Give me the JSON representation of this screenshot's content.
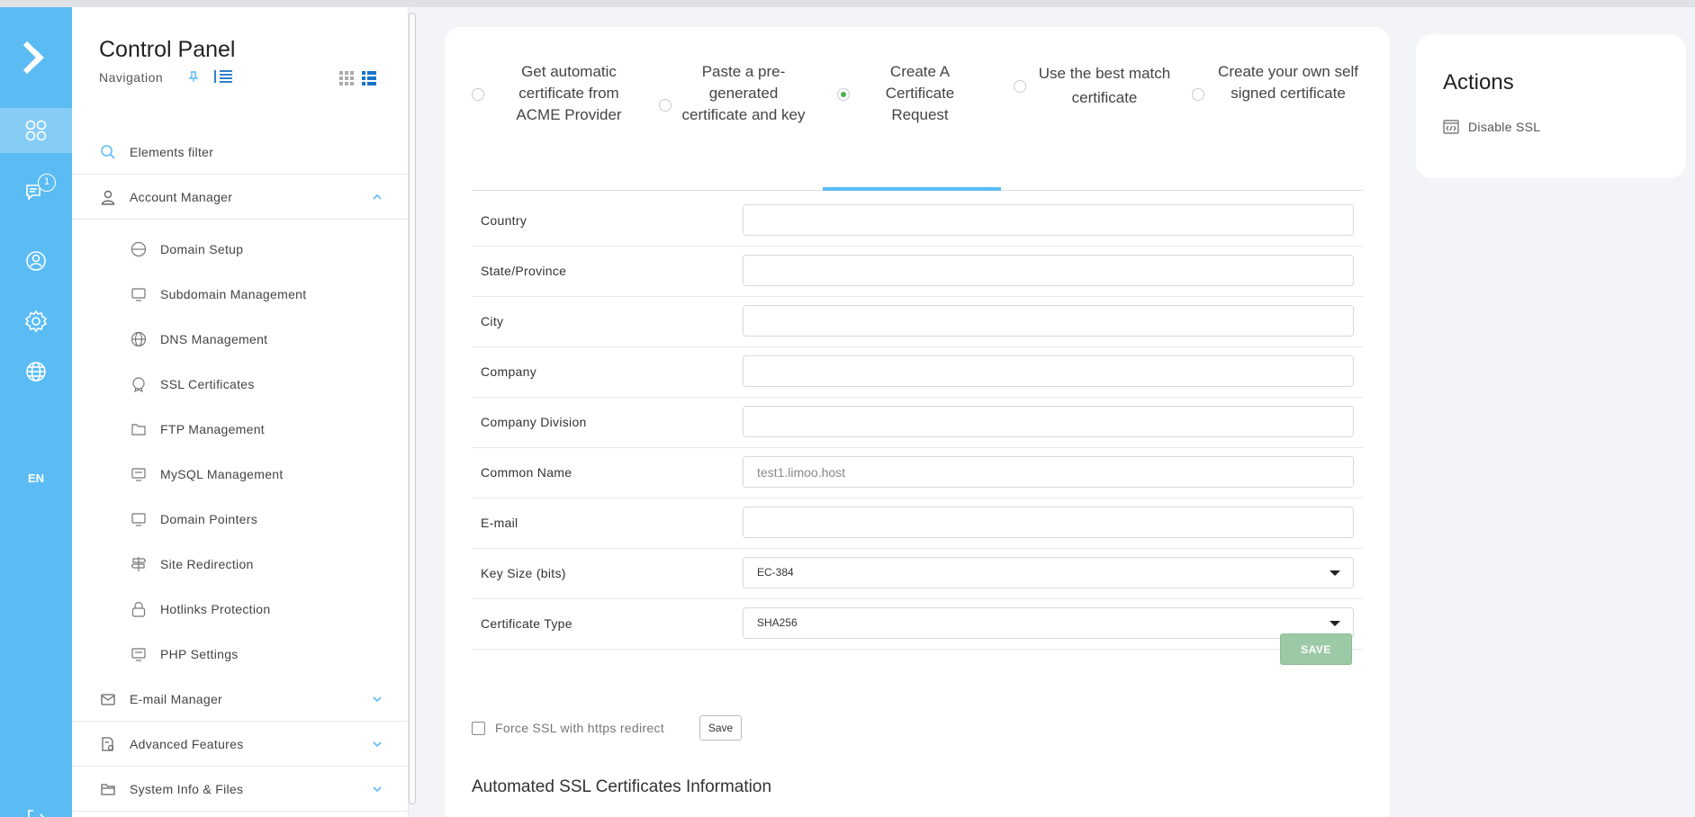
{
  "rail": {
    "badge_count": "1",
    "language": "EN",
    "icons": [
      "logo-icon",
      "dashboard-icon",
      "messages-icon",
      "user-icon",
      "settings-icon",
      "globe-icon",
      "logout-icon"
    ]
  },
  "sidebar": {
    "title": "Control Panel",
    "subtitle": "Navigation",
    "filter_label": "Elements filter",
    "account_manager": "Account Manager",
    "items": [
      {
        "label": "Domain Setup",
        "icon": "domain-setup-icon"
      },
      {
        "label": "Subdomain Management",
        "icon": "subdomain-icon"
      },
      {
        "label": "DNS Management",
        "icon": "dns-icon"
      },
      {
        "label": "SSL Certificates",
        "icon": "ssl-icon"
      },
      {
        "label": "FTP Management",
        "icon": "ftp-icon"
      },
      {
        "label": "MySQL Management",
        "icon": "mysql-icon"
      },
      {
        "label": "Domain Pointers",
        "icon": "domain-pointers-icon"
      },
      {
        "label": "Site Redirection",
        "icon": "site-redirection-icon"
      },
      {
        "label": "Hotlinks Protection",
        "icon": "lock-icon"
      },
      {
        "label": "PHP Settings",
        "icon": "php-icon"
      }
    ],
    "sections": [
      {
        "label": "E-mail Manager"
      },
      {
        "label": "Advanced Features"
      },
      {
        "label": "System Info & Files"
      }
    ]
  },
  "tabs": [
    {
      "label": "Get automatic certificate from ACME Provider",
      "selected": false
    },
    {
      "label": "Paste a pre-generated certificate and key",
      "selected": false
    },
    {
      "label": "Create A Certificate Request",
      "selected": true
    },
    {
      "label": "Use the best match certificate",
      "selected": false
    },
    {
      "label": "Create your own self signed certificate",
      "selected": false
    }
  ],
  "form": {
    "country": {
      "label": "Country",
      "value": ""
    },
    "state": {
      "label": "State/Province",
      "value": ""
    },
    "city": {
      "label": "City",
      "value": ""
    },
    "company": {
      "label": "Company",
      "value": ""
    },
    "division": {
      "label": "Company Division",
      "value": ""
    },
    "common_name": {
      "label": "Common Name",
      "value": "",
      "placeholder": "test1.limoo.host"
    },
    "email": {
      "label": "E-mail",
      "value": ""
    },
    "key_size": {
      "label": "Key Size (bits)",
      "value": "EC-384"
    },
    "cert_type": {
      "label": "Certificate Type",
      "value": "SHA256"
    },
    "save_label": "SAVE"
  },
  "force_ssl": {
    "label": "Force SSL with https redirect",
    "checked": false,
    "save_label": "Save"
  },
  "automated_title": "Automated SSL Certificates Information",
  "actions": {
    "title": "Actions",
    "disable_ssl": "Disable SSL"
  },
  "colors": {
    "accent": "#5bbcf4",
    "save_button": "#9ccaa6",
    "radio_selected": "#4caf50"
  }
}
